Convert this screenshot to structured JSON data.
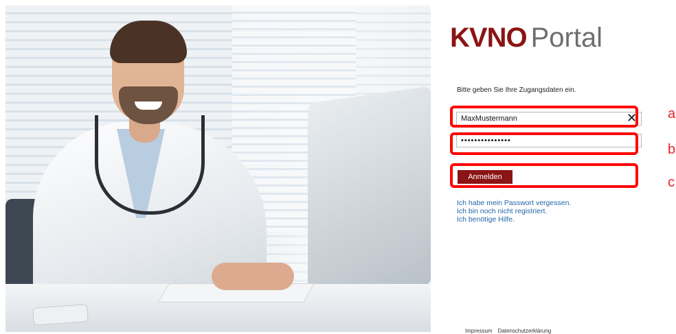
{
  "hero": {
    "image_alt": "Smiling doctor with stethoscope sitting at a computer desk"
  },
  "brand": {
    "name": "KVNO",
    "suffix": "Portal",
    "color": "#8b1414"
  },
  "login": {
    "instruction": "Bitte geben Sie Ihre Zugangsdaten ein.",
    "username_value": "MaxMustermann",
    "password_masked": "•••••••••••••••",
    "clear_symbol": "✕",
    "submit_label": "Anmelden"
  },
  "links": [
    "Ich habe mein Passwort vergessen.",
    "Ich bin noch nicht registriert.",
    "Ich benötige Hilfe."
  ],
  "footer": [
    "Impressum",
    "Datenschutzerklärung"
  ],
  "annotations": {
    "labels": [
      "a",
      "b",
      "c"
    ],
    "color": "#ff0000"
  }
}
